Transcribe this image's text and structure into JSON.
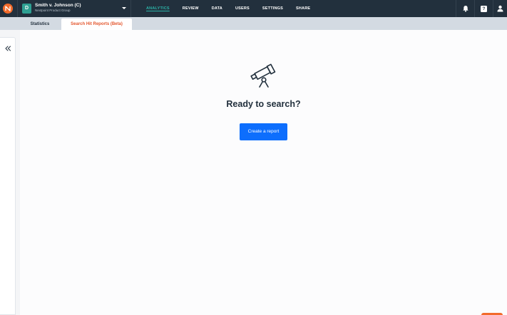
{
  "header": {
    "logo_icon": "nextpoint-logo-icon",
    "case": {
      "avatar_letter": "D",
      "title": "Smith v. Johnson (C)",
      "subtitle": "Nextpoint Product Group"
    },
    "nav": [
      {
        "label": "ANALYTICS",
        "active": true
      },
      {
        "label": "REVIEW",
        "active": false
      },
      {
        "label": "DATA",
        "active": false
      },
      {
        "label": "USERS",
        "active": false
      },
      {
        "label": "SETTINGS",
        "active": false
      },
      {
        "label": "SHARE",
        "active": false
      }
    ],
    "icons": [
      "bell-icon",
      "help-icon",
      "user-icon"
    ],
    "help_glyph": "?"
  },
  "tabs": [
    {
      "label": "Statistics",
      "active": false
    },
    {
      "label": "Search Hit Reports (Beta)",
      "active": true
    }
  ],
  "sidebar": {
    "collapse_icon": "double-chevron-left-icon"
  },
  "main": {
    "empty_icon": "telescope-icon",
    "title": "Ready to search?",
    "button_label": "Create a report"
  },
  "colors": {
    "topbar": "#22303d",
    "accent_teal": "#2bb3a8",
    "active_tab_text": "#e4572e",
    "primary_button": "#0d6efd",
    "brand_orange": "#f26b2b"
  }
}
